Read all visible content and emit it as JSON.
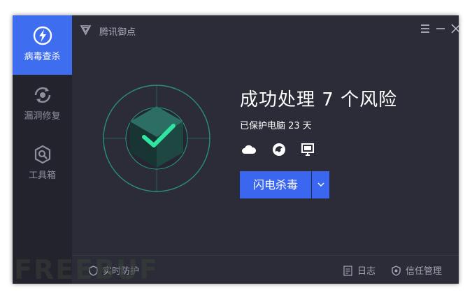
{
  "app": {
    "title": "腾讯御点"
  },
  "sidebar": {
    "items": [
      {
        "label": "病毒查杀",
        "icon": "lightning-icon",
        "active": true
      },
      {
        "label": "漏洞修复",
        "icon": "repair-icon",
        "active": false
      },
      {
        "label": "工具箱",
        "icon": "toolbox-icon",
        "active": false
      }
    ]
  },
  "window_controls": [
    "menu-icon",
    "minimize-icon",
    "close-icon"
  ],
  "main": {
    "headline": "成功处理 7 个风险",
    "subtitle": "已保护电脑 23 天",
    "services": [
      "cloud-icon",
      "browser-icon",
      "monitor-icon"
    ],
    "scan_button": "闪电杀毒"
  },
  "footer": {
    "realtime": "实时防护",
    "log": "日志",
    "trust": "信任管理"
  },
  "watermark": "FREEBUF",
  "colors": {
    "accent": "#3b66ef",
    "background": "#2b2c38",
    "sidebar": "#23232d",
    "shield": "#2aa889"
  }
}
